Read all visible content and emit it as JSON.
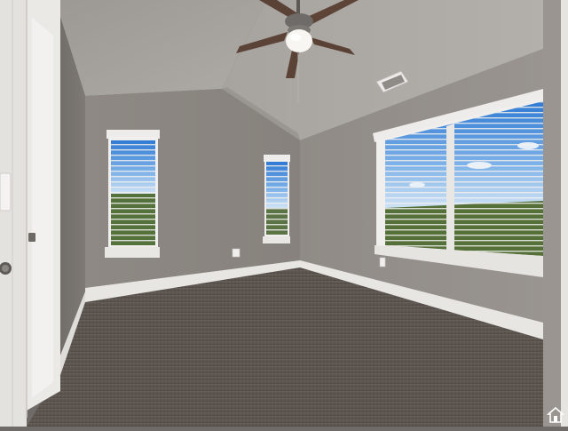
{
  "scene": {
    "description_tags": [
      "empty-bedroom",
      "vaulted-ceiling",
      "ceiling-fan",
      "carpet",
      "windows-with-blinds"
    ],
    "colors": {
      "wall_gray": "#8d8883",
      "ceiling": "#a5a19d",
      "carpet": "#5e5650",
      "trim_white": "#e8e6e3",
      "sky_blue": "#3f86d8",
      "foliage_green": "#4f6a38"
    },
    "icons": {
      "watermark": "house-icon"
    }
  }
}
